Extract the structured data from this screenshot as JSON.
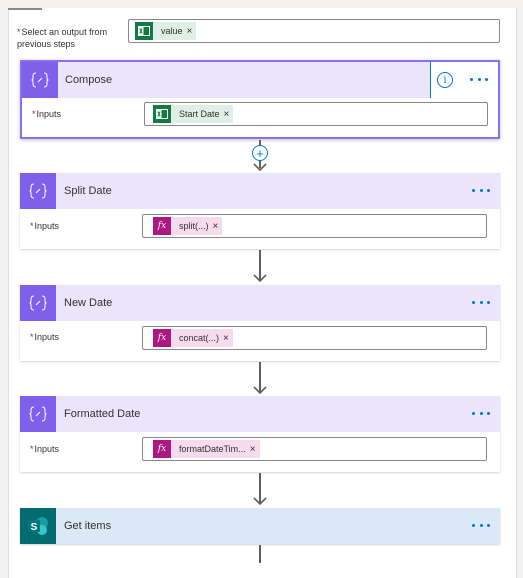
{
  "select_output": {
    "label": "Select an output from previous steps",
    "token": {
      "label": "value",
      "icon": "excel-icon"
    }
  },
  "cards": [
    {
      "title": "Compose",
      "inputs_label": "Inputs",
      "token": {
        "label": "Start Date",
        "icon": "excel-icon"
      },
      "selected": true
    },
    {
      "title": "Split Date",
      "inputs_label": "Inputs",
      "token": {
        "label": "split(...)",
        "icon": "fx-icon",
        "icon_text": "fx"
      }
    },
    {
      "title": "New Date",
      "inputs_label": "Inputs",
      "token": {
        "label": "concat(...)",
        "icon": "fx-icon",
        "icon_text": "fx"
      }
    },
    {
      "title": "Formatted Date",
      "inputs_label": "Inputs",
      "token": {
        "label": "formatDateTim...",
        "icon": "fx-icon",
        "icon_text": "fx"
      }
    },
    {
      "title": "Get items",
      "icon": "sharepoint-icon",
      "icon_text": "S"
    }
  ],
  "required_mark": "*",
  "remove_mark": "×",
  "colors": {
    "compose_accent": "#8060ea",
    "sharepoint": "#036c70",
    "link": "#0078d4",
    "excel_token": "#107c41",
    "expression_token": "#ad1780"
  }
}
